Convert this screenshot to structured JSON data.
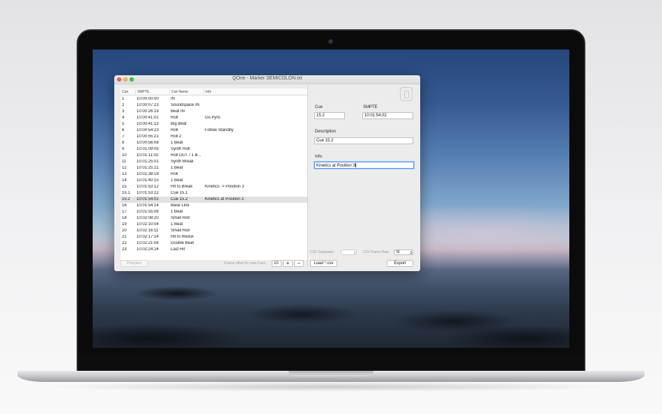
{
  "window": {
    "title": "QOne - Marker SEMICOLON.txt"
  },
  "table": {
    "headers": {
      "cue": "Cue",
      "smpte": "SMPTE",
      "cue_name": "Cue Name",
      "info": "Info"
    },
    "selected_index": 14,
    "rows": [
      {
        "cue": "1",
        "smpte": "10:00:00:00",
        "name": "IN",
        "info": ""
      },
      {
        "cue": "2",
        "smpte": "10:00:07:23",
        "name": "Soundspace IN",
        "info": ""
      },
      {
        "cue": "3",
        "smpte": "10:00:26:19",
        "name": "Beat IN",
        "info": ""
      },
      {
        "cue": "4",
        "smpte": "10:00:41:01",
        "name": "Roll",
        "info": "Go Pyro"
      },
      {
        "cue": "5",
        "smpte": "10:00:41:13",
        "name": "Big Beat",
        "info": ""
      },
      {
        "cue": "6",
        "smpte": "10:00:54:23",
        "name": "Roll",
        "info": "Follow Standby"
      },
      {
        "cue": "7",
        "smpte": "10:00:55:21",
        "name": "Roll 2",
        "info": ""
      },
      {
        "cue": "8",
        "smpte": "10:00:56:08",
        "name": "1 Beat",
        "info": ""
      },
      {
        "cue": "9",
        "smpte": "10:01:09:05",
        "name": "Synth Roll",
        "info": ""
      },
      {
        "cue": "10",
        "smpte": "10:01:11:02",
        "name": "Roll OUT / 1 B...",
        "info": ""
      },
      {
        "cue": "11",
        "smpte": "10:01:25:01",
        "name": "Synth Break",
        "info": ""
      },
      {
        "cue": "12",
        "smpte": "10:01:25:21",
        "name": "1 Beat",
        "info": ""
      },
      {
        "cue": "13",
        "smpte": "10:01:38:19",
        "name": "Roll",
        "info": ""
      },
      {
        "cue": "14",
        "smpte": "10:01:40:15",
        "name": "1 Beat",
        "info": ""
      },
      {
        "cue": "15",
        "smpte": "10:01:53:12",
        "name": "Hit to Break",
        "info": "Kinetics -> Position 3"
      },
      {
        "cue": "15.1",
        "smpte": "10:01:53:22",
        "name": "Cue 15.1",
        "info": ""
      },
      {
        "cue": "15.2",
        "smpte": "10:01:54:02",
        "name": "Cue 15.2",
        "info": "Kinetics at Position 3"
      },
      {
        "cue": "16",
        "smpte": "10:01:54:14",
        "name": "Base Line",
        "info": ""
      },
      {
        "cue": "17",
        "smpte": "10:01:55:08",
        "name": "1 Beat",
        "info": ""
      },
      {
        "cue": "18",
        "smpte": "10:02:08:20",
        "name": "Small Roll",
        "info": ""
      },
      {
        "cue": "19",
        "smpte": "10:02:10:04",
        "name": "1 Beat",
        "info": ""
      },
      {
        "cue": "20",
        "smpte": "10:02:16:11",
        "name": "Small Roll",
        "info": ""
      },
      {
        "cue": "21",
        "smpte": "10:02:17:14",
        "name": "Hit to Redux",
        "info": ""
      },
      {
        "cue": "22",
        "smpte": "10:02:21:06",
        "name": "Double Beat",
        "info": ""
      },
      {
        "cue": "23",
        "smpte": "10:02:24:24",
        "name": "Last Hit",
        "info": ""
      }
    ]
  },
  "detail": {
    "cue_label": "Cue",
    "cue_value": "15.2",
    "smpte_label": "SMPTE",
    "smpte_value": "10:01:54:02",
    "description_label": "Description",
    "description_value": "Cue 15.2",
    "info_label": "Info",
    "info_value": "Kinetics at Position 3"
  },
  "csv": {
    "separator_label": "CSV Separator:",
    "separator_value": ";",
    "frame_rate_label": "CSV Frame Rate:",
    "frame_rate_value": "30"
  },
  "bottom": {
    "prepare_label": "Prepare",
    "frame_offset_label": "Frame offset for new Cues:",
    "frame_offset_value": "10",
    "plus_label": "+",
    "minus_label": "−",
    "load_csv_label": "Load *.csv",
    "export_label": "Export"
  },
  "colors": {
    "selection_row": "#e2e2e2",
    "focus_ring": "#5b9bf0",
    "close": "#fc605c",
    "minimize": "#fdbc40",
    "zoom": "#34c84a"
  }
}
